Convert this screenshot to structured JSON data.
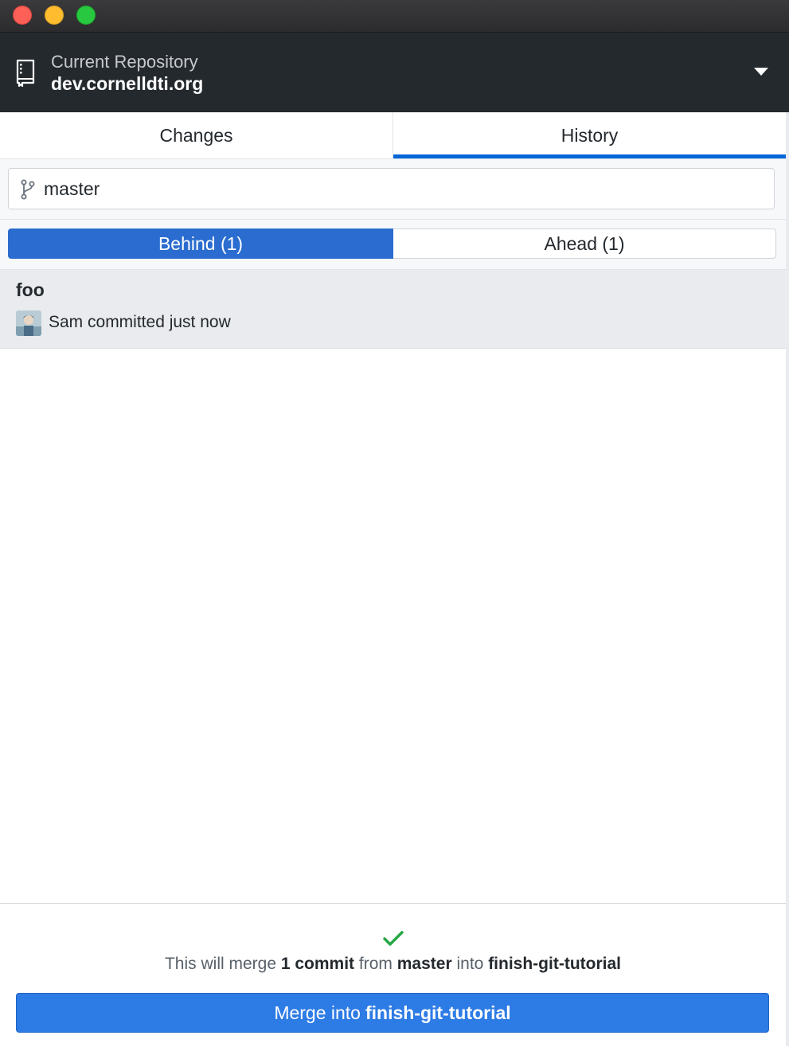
{
  "toolbar": {
    "repo_label": "Current Repository",
    "repo_name": "dev.cornelldti.org"
  },
  "tabs": [
    {
      "label": "Changes",
      "selected": false
    },
    {
      "label": "History",
      "selected": true
    }
  ],
  "branch": {
    "name": "master",
    "icon": "git-branch-icon"
  },
  "segments": {
    "behind": "Behind (1)",
    "ahead": "Ahead (1)",
    "selected": "behind"
  },
  "commits": [
    {
      "title": "foo",
      "meta": "Sam committed just now"
    }
  ],
  "merge": {
    "prefix": "This will merge",
    "count": "1 commit",
    "from_word": "from",
    "source": "master",
    "into_word": "into",
    "target": "finish-git-tutorial",
    "button_prefix": "Merge into",
    "button_target": "finish-git-tutorial"
  },
  "colors": {
    "accent": "#2d7be5",
    "toolbar_bg": "#24292e",
    "success": "#28a745"
  }
}
